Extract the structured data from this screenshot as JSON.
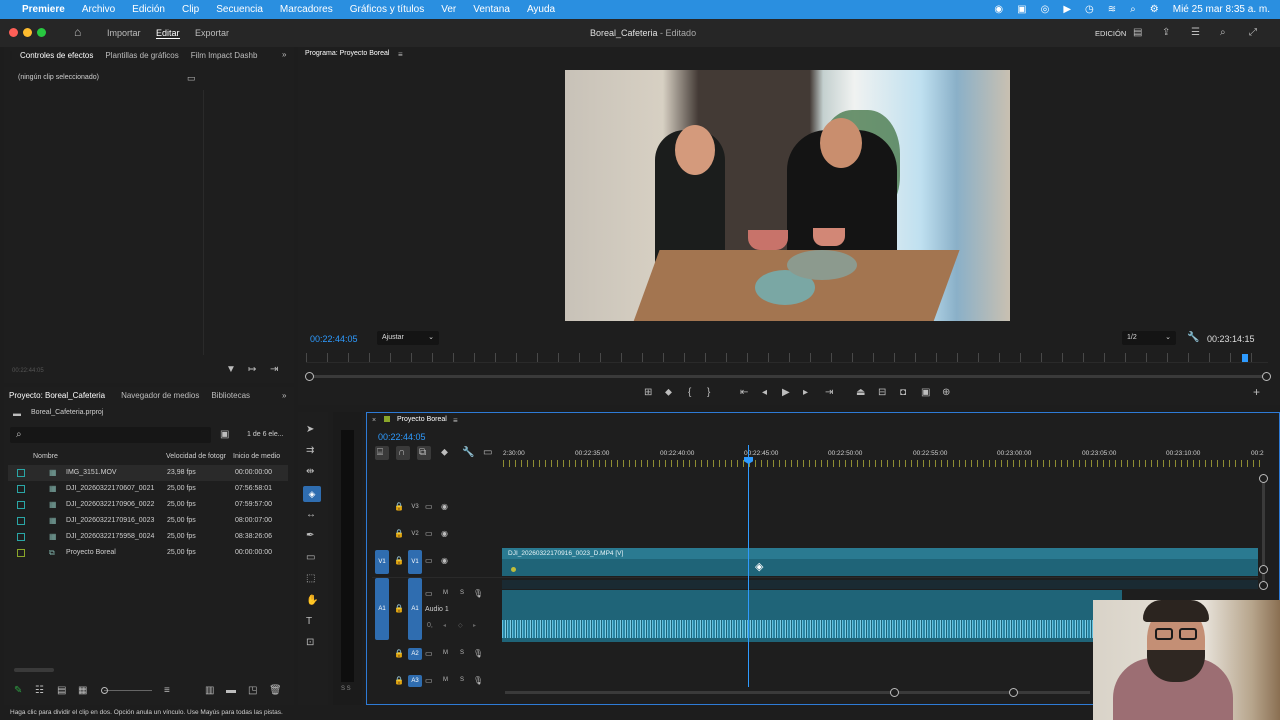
{
  "menubar": {
    "app": "Premiere",
    "items": [
      "Archivo",
      "Edición",
      "Clip",
      "Secuencia",
      "Marcadores",
      "Gráficos y títulos",
      "Ver",
      "Ventana",
      "Ayuda"
    ],
    "clock": "Mié 25 mar 8:35 a. m."
  },
  "header": {
    "nav": [
      "Importar",
      "Editar",
      "Exportar"
    ],
    "active_nav": "Editar",
    "title": "Boreal_Cafeteria",
    "title_suffix": " - Editado",
    "workspace": "EDICIÓN"
  },
  "effects_panel": {
    "tabs": [
      "Controles de efectos",
      "Plantillas de gráficos",
      "Film Impact Dashb"
    ],
    "empty_text": "(ningún clip seleccionado)",
    "timecode": "00:22:44:05"
  },
  "program_monitor": {
    "title": "Programa: Proyecto Boreal",
    "timecode_left": "00:22:44:05",
    "fit_label": "Ajustar",
    "resolution": "1/2",
    "duration": "00:23:14:15"
  },
  "project_panel": {
    "tabs": [
      "Proyecto: Boreal_Cafeteria",
      "Navegador de medios",
      "Bibliotecas"
    ],
    "file": "Boreal_Cafeteria.prproj",
    "count": "1 de 6 ele...",
    "columns": [
      "Nombre",
      "Velocidad de fotogr",
      "Inicio de medio"
    ],
    "rows": [
      {
        "name": "IMG_3151.MOV",
        "fps": "23,98 fps",
        "start": "00:00:00:00",
        "color": "#2aa6a6"
      },
      {
        "name": "DJI_20260322170607_0021",
        "fps": "25,00 fps",
        "start": "07:56:58:01",
        "color": "#2aa6a6"
      },
      {
        "name": "DJI_20260322170906_0022",
        "fps": "25,00 fps",
        "start": "07:59:57:00",
        "color": "#2aa6a6"
      },
      {
        "name": "DJI_20260322170916_0023",
        "fps": "25,00 fps",
        "start": "08:00:07:00",
        "color": "#2aa6a6"
      },
      {
        "name": "DJI_20260322175958_0024",
        "fps": "25,00 fps",
        "start": "08:38:26:06",
        "color": "#2aa6a6"
      },
      {
        "name": "Proyecto Boreal",
        "fps": "25,00 fps",
        "start": "00:00:00:00",
        "color": "#8aa62a"
      }
    ]
  },
  "timeline": {
    "tab": "Proyecto Boreal",
    "timecode": "00:22:44:05",
    "ruler": [
      "2:30:00",
      "00:22:35:00",
      "00:22:40:00",
      "00:22:45:00",
      "00:22:50:00",
      "00:22:55:00",
      "00:23:00:00",
      "00:23:05:00",
      "00:23:10:00",
      "00:2"
    ],
    "tracks": {
      "v3": "V3",
      "v2": "V2",
      "v1": "V1",
      "a1": "A1",
      "a2": "A2",
      "a3": "A3",
      "audio1_name": "Audio 1",
      "m": "M",
      "s": "S",
      "vol": "0,"
    },
    "clip_label": "DJI_20260322170916_0023_D.MP4 [V]",
    "meter_label": "S S"
  },
  "status_bar": "Haga clic para dividir el clip en dos. Opción anula un vínculo. Use Mayús para todas las pistas."
}
